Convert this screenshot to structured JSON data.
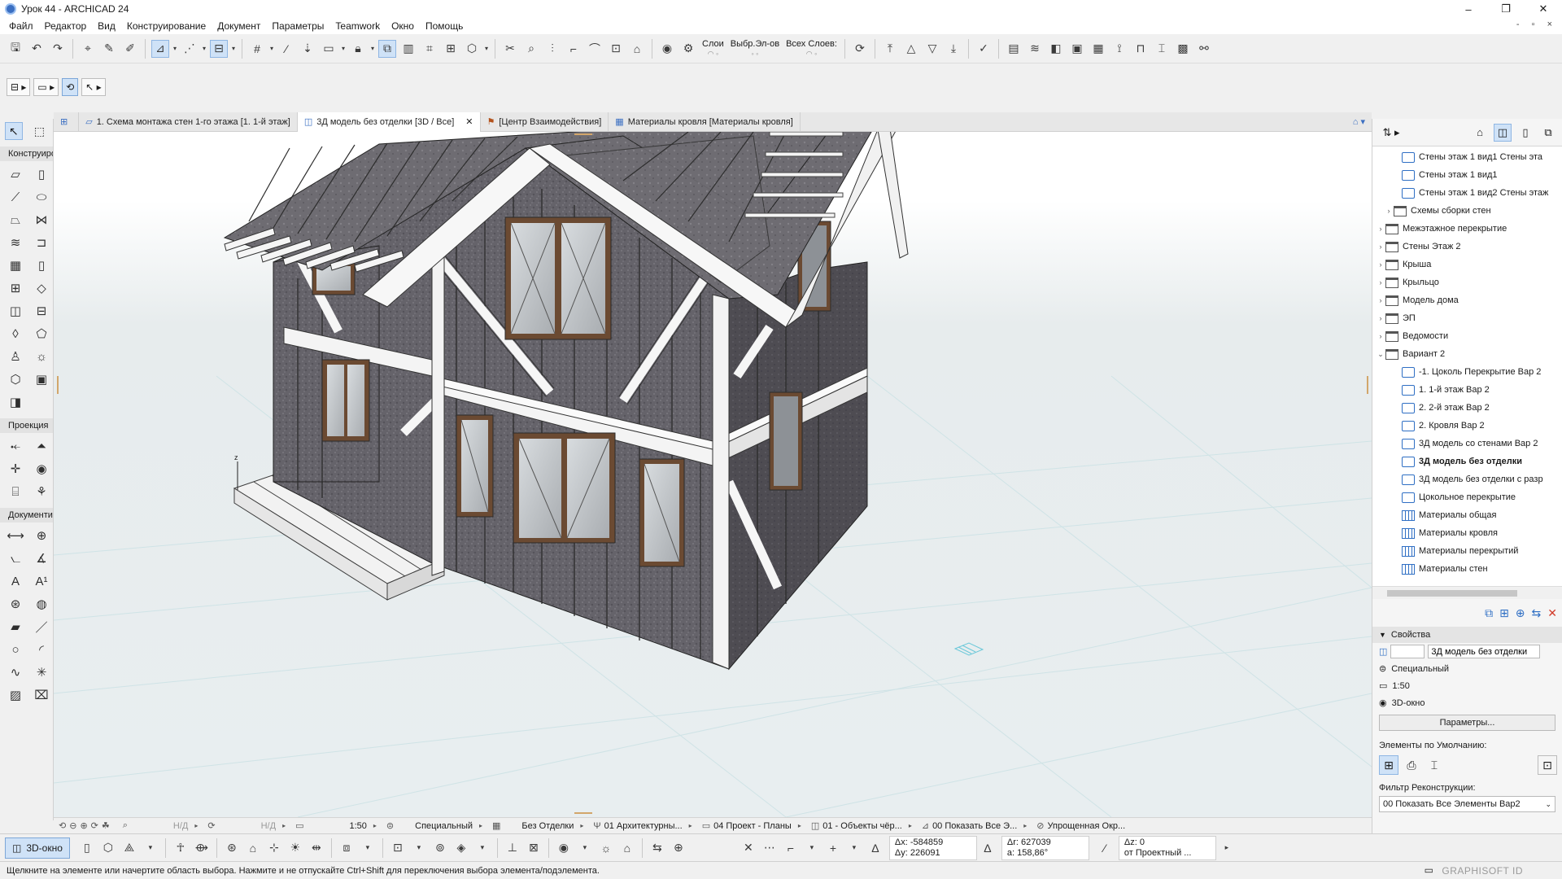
{
  "window": {
    "title": "Урок 44 - ARCHICAD 24",
    "minimize": "–",
    "maximize": "❐",
    "close": "✕",
    "doc_controls": "- ▫ ×"
  },
  "menu": [
    "Файл",
    "Редактор",
    "Вид",
    "Конструирование",
    "Документ",
    "Параметры",
    "Teamwork",
    "Окно",
    "Помощь"
  ],
  "toolbar": {
    "layers_label": "Слои",
    "selected_label": "Выбр.Эл-ов",
    "all_layers_label": "Всех Слоев:"
  },
  "toolbox": {
    "section_design": "Конструиро",
    "section_view": "Проекция",
    "section_document": "Документир"
  },
  "tabs": [
    {
      "label": "1. Схема монтажа стен 1-го этажа [1. 1-й этаж]",
      "active": false
    },
    {
      "label": "3Д модель без отделки [3D / Все]",
      "active": true
    },
    {
      "label": "[Центр Взаимодействия]",
      "active": false
    },
    {
      "label": "Материалы кровля [Материалы кровля]",
      "active": false
    }
  ],
  "viewbar": {
    "nd1": "Н/Д",
    "nd2": "Н/Д",
    "scale": "1:50",
    "structure": "Специальный",
    "finish": "Без Отделки",
    "arch": "01 Архитектурны...",
    "plans": "04 Проект - Планы",
    "objects": "01 - Объекты чёр...",
    "show_all": "00 Показать Все Э...",
    "simplified": "Упрощенная Окр..."
  },
  "infobar": {
    "btn_3d": "3D-окно",
    "dx": "Δx: -584859",
    "dy": "Δy: 226091",
    "dr": "Δr: 627039",
    "da": "a: 158,86°",
    "dz": "Δz: 0",
    "dz_ref": "от Проектный ..."
  },
  "navigator": {
    "items": [
      {
        "label": "Стены этаж 1 вид1 Стены эта",
        "icon": "view",
        "level": 2,
        "exp": ""
      },
      {
        "label": "Стены этаж 1 вид1",
        "icon": "view",
        "level": 2,
        "exp": ""
      },
      {
        "label": "Стены этаж 1 вид2 Стены этаж",
        "icon": "view",
        "level": 2,
        "exp": ""
      },
      {
        "label": "Схемы сборки стен",
        "icon": "folder",
        "level": 1,
        "exp": "›"
      },
      {
        "label": "Межэтажное перекрытие",
        "icon": "folder",
        "level": 0,
        "exp": "›"
      },
      {
        "label": "Стены Этаж 2",
        "icon": "folder",
        "level": 0,
        "exp": "›"
      },
      {
        "label": "Крыша",
        "icon": "folder",
        "level": 0,
        "exp": "›"
      },
      {
        "label": "Крыльцо",
        "icon": "folder",
        "level": 0,
        "exp": "›"
      },
      {
        "label": "Модель дома",
        "icon": "folder",
        "level": 0,
        "exp": "›"
      },
      {
        "label": "ЭП",
        "icon": "folder",
        "level": 0,
        "exp": "›"
      },
      {
        "label": "Ведомости",
        "icon": "folder",
        "level": 0,
        "exp": "›"
      },
      {
        "label": "Вариант 2",
        "icon": "folder",
        "level": 0,
        "exp": "⌄"
      },
      {
        "label": "-1. Цоколь Перекрытие Вар 2",
        "icon": "plan",
        "level": 2,
        "exp": ""
      },
      {
        "label": "1. 1-й этаж Вар 2",
        "icon": "plan",
        "level": 2,
        "exp": ""
      },
      {
        "label": "2. 2-й этаж Вар 2",
        "icon": "plan",
        "level": 2,
        "exp": ""
      },
      {
        "label": "2. Кровля Вар 2",
        "icon": "plan",
        "level": 2,
        "exp": ""
      },
      {
        "label": "3Д модель со стенами Вар 2",
        "icon": "view",
        "level": 2,
        "exp": ""
      },
      {
        "label": "3Д модель без отделки",
        "icon": "view",
        "level": 2,
        "exp": "",
        "bold": true
      },
      {
        "label": "3Д модель без отделки с разр",
        "icon": "view",
        "level": 2,
        "exp": ""
      },
      {
        "label": "Цокольное перекрытие",
        "icon": "view",
        "level": 2,
        "exp": ""
      },
      {
        "label": "Материалы общая",
        "icon": "sheet",
        "level": 2,
        "exp": ""
      },
      {
        "label": "Материалы кровля",
        "icon": "sheet",
        "level": 2,
        "exp": ""
      },
      {
        "label": "Материалы перекрытий",
        "icon": "sheet",
        "level": 2,
        "exp": ""
      },
      {
        "label": "Материалы стен",
        "icon": "sheet",
        "level": 2,
        "exp": ""
      }
    ]
  },
  "properties": {
    "header": "Свойства",
    "name_value": "3Д модель без отделки",
    "structure": "Специальный",
    "scale": "1:50",
    "mode": "3D-окно",
    "params_button": "Параметры...",
    "defaults_label": "Элементы по Умолчанию:",
    "filter_label": "Фильтр Реконструкции:",
    "filter_value": "00 Показать Все Элементы Вар2"
  },
  "status": {
    "hint": "Щелкните на элементе или начертите область выбора. Нажмите и не отпускайте Ctrl+Shift для переключения выбора элемента/подэлемента.",
    "brand": "GRAPHISOFT ID"
  },
  "colors": {
    "accent": "#cfe2f7",
    "nav_blue": "#2f6fc4",
    "osb_dark": "#5f5d62",
    "timber": "#f4f4f4",
    "window_frame": "#6b4a32"
  }
}
